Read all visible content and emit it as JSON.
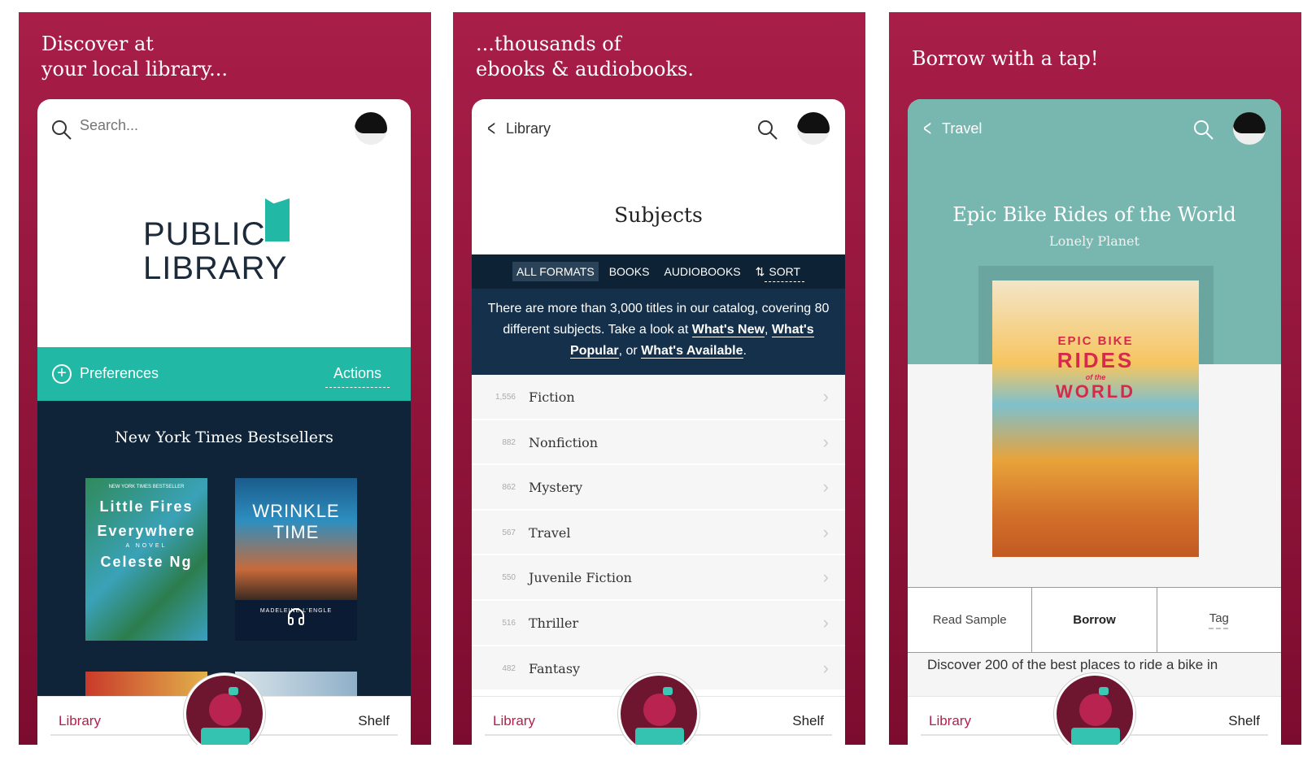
{
  "colors": {
    "brand_red": "#a81e48",
    "teal": "#21b9a5",
    "navy": "#0f2438"
  },
  "panels": [
    {
      "caption": "Discover at\nyour local library...",
      "search_placeholder": "Search...",
      "logo_text": [
        "PUBLIC",
        "LIBRARY"
      ],
      "preferences_label": "Preferences",
      "actions_label": "Actions",
      "section_title": "New York Times Bestsellers",
      "books": [
        {
          "tag": "NEW YORK TIMES BESTSELLER",
          "title": "Little Fires Everywhere",
          "subtitle": "A NOVEL",
          "author": "Celeste Ng",
          "format": "ebook"
        },
        {
          "title": "WRINKLE TIME",
          "author": "MADELEINE L'ENGLE",
          "format": "audiobook",
          "icon": "headphones-icon"
        }
      ],
      "nav": {
        "library": "Library",
        "shelf": "Shelf"
      }
    },
    {
      "caption": "...thousands of\nebooks & audiobooks.",
      "back_label": "Library",
      "page_title": "Subjects",
      "tabs": [
        "ALL FORMATS",
        "BOOKS",
        "AUDIOBOOKS"
      ],
      "active_tab": "ALL FORMATS",
      "sort_label": "SORT",
      "description": {
        "text1": "There are more than 3,000 titles in our catalog, covering 80 different subjects. Take a look at ",
        "link1": "What's New",
        "sep1": ", ",
        "link2": "What's Popular",
        "sep2": ", or ",
        "link3": "What's Available",
        "end": "."
      },
      "subjects": [
        {
          "count": "1,556",
          "name": "Fiction"
        },
        {
          "count": "882",
          "name": "Nonfiction"
        },
        {
          "count": "862",
          "name": "Mystery"
        },
        {
          "count": "567",
          "name": "Travel"
        },
        {
          "count": "550",
          "name": "Juvenile Fiction"
        },
        {
          "count": "516",
          "name": "Thriller"
        },
        {
          "count": "482",
          "name": "Fantasy"
        }
      ],
      "nav": {
        "library": "Library",
        "shelf": "Shelf"
      }
    },
    {
      "caption": "Borrow with a tap!",
      "back_label": "Travel",
      "book_title": "Epic Bike Rides of the World",
      "book_author": "Lonely Planet",
      "cover_text": [
        "EPIC BIKE",
        "RIDES",
        "of the",
        "WORLD"
      ],
      "actions": [
        "Read Sample",
        "Borrow",
        "Tag"
      ],
      "blurb": "Discover 200 of the best places to ride a bike in",
      "nav": {
        "library": "Library",
        "shelf": "Shelf"
      }
    }
  ]
}
